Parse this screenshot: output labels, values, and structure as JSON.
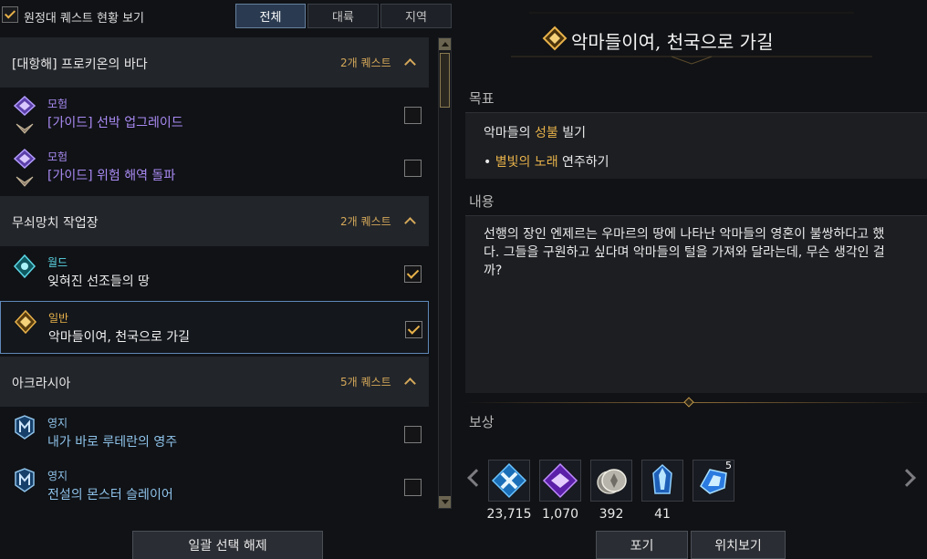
{
  "header": {
    "show_label": "원정대 퀘스트 현황 보기",
    "show_checked": true,
    "tabs": [
      {
        "label": "전체",
        "active": true
      },
      {
        "label": "대륙",
        "active": false
      },
      {
        "label": "지역",
        "active": false
      }
    ]
  },
  "groups": [
    {
      "title": "[대항해] 프로키온의 바다",
      "count": "2개 퀘스트",
      "quests": [
        {
          "category": "모험",
          "name": "[가이드] 선박 업그레이드",
          "checked": false,
          "color": "#a98af2"
        },
        {
          "category": "모험",
          "name": "[가이드] 위험 해역 돌파",
          "checked": false,
          "color": "#a98af2"
        }
      ]
    },
    {
      "title": "무쇠망치 작업장",
      "count": "2개 퀘스트",
      "quests": [
        {
          "category": "월드",
          "name": "잊혀진 선조들의 땅",
          "checked": true,
          "color": "#5cd7e6"
        },
        {
          "category": "일반",
          "name": "악마들이여, 천국으로 가길",
          "checked": true,
          "selected": true,
          "color": "#e8b24a"
        }
      ]
    },
    {
      "title": "아크라시아",
      "count": "5개 퀘스트",
      "quests": [
        {
          "category": "영지",
          "name": "내가 바로 루테란의 영주",
          "checked": false,
          "color": "#8fc3ea"
        },
        {
          "category": "영지",
          "name": "전설의 몬스터 슬레이어",
          "checked": false,
          "color": "#8fc3ea"
        }
      ]
    }
  ],
  "footer": {
    "deselect_label": "일괄 선택 해제"
  },
  "detail": {
    "title": "악마들이여, 천국으로 가길",
    "goal_label": "목표",
    "goal_1_pre": "악마들의 ",
    "goal_1_hl": "성불",
    "goal_1_post": " 빌기",
    "goal_2_bullet": "•",
    "goal_2_hl": "별빛의 노래",
    "goal_2_post": " 연주하기",
    "content_label": "내용",
    "content_text": "선행의 장인 엔제르는 우마르의 땅에 나타난 악마들의 영혼이 불쌍하다고 했다. 그들을 구원하고 싶다며 악마들의 털을 가져와 달라는데, 무슨 생각인 걸까?",
    "reward_label": "보상",
    "rewards": [
      {
        "icon": "blue-hammer-icon",
        "count": "23,715"
      },
      {
        "icon": "purple-crest-icon",
        "count": "1,070"
      },
      {
        "icon": "silver-coin-icon",
        "count": "392"
      },
      {
        "icon": "blue-crystal-icon",
        "count": "41"
      },
      {
        "icon": "blue-gem-icon",
        "count": "",
        "badge": "5"
      }
    ],
    "abandon_label": "포기",
    "locate_label": "위치보기"
  },
  "colors": {
    "accent_gold": "#e8b24a",
    "selected_border": "#5f88b8"
  }
}
